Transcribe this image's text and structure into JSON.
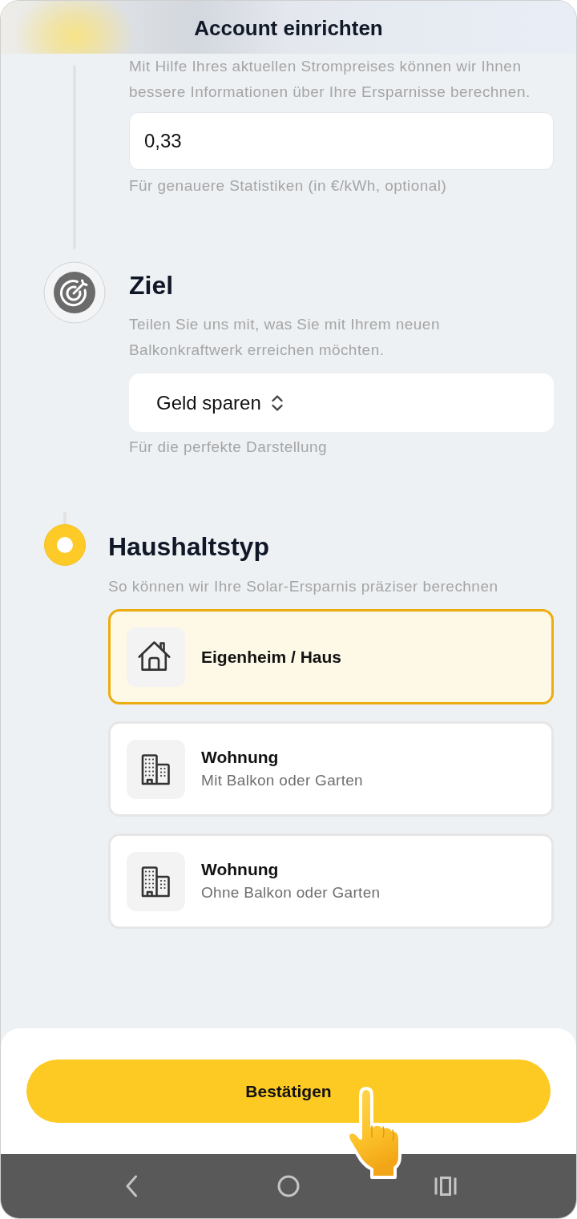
{
  "header": {
    "title": "Account einrichten"
  },
  "steps": [
    {
      "kind": "input",
      "description": "Mit Hilfe Ihres aktuellen Strompreises können wir Ihnen bessere Informationen über Ihre Ersparnisse berechnen.",
      "value": "0,33",
      "hint": "Für genauere Statistiken (in €/kWh, optional)"
    },
    {
      "kind": "select",
      "title": "Ziel",
      "current": false,
      "description": "Teilen Sie uns mit, was Sie mit Ihrem neuen Balkonkraftwerk erreichen möchten.",
      "value": "Geld sparen",
      "hint": "Für die perfekte Darstellung"
    },
    {
      "kind": "options",
      "title": "Haushaltstyp",
      "current": true,
      "description": "So können wir Ihre Solar-Ersparnis präziser berechnen",
      "options": [
        {
          "kind": "house",
          "title": "Eigenheim / Haus",
          "selected": true
        },
        {
          "kind": "apartment",
          "title": "Wohnung",
          "subtitle": "Mit Balkon oder Garten",
          "selected": false
        },
        {
          "kind": "apartment",
          "title": "Wohnung",
          "subtitle": "Ohne Balkon oder Garten",
          "selected": false
        }
      ]
    }
  ],
  "confirm_button": {
    "label": "Bestätigen"
  }
}
